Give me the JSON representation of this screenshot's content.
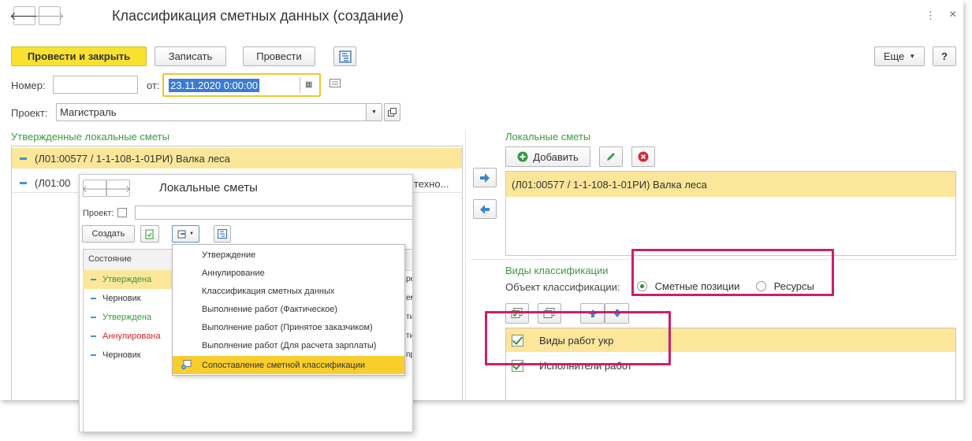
{
  "window": {
    "title": "Классификация сметных данных (создание)",
    "more_icon": "⋮",
    "close_icon": "×"
  },
  "toolbar": {
    "post_close": "Провести и закрыть",
    "save": "Записать",
    "post": "Провести",
    "more": "Еще",
    "help": "?"
  },
  "form": {
    "number_label": "Номер:",
    "number_value": "",
    "from_label": "от:",
    "date_value": "23.11.2020  0:00:00",
    "project_label": "Проект:",
    "project_value": "Магистраль"
  },
  "approved": {
    "title": "Утвержденные локальные сметы",
    "rows": [
      {
        "text": "(Л01:00577 / 1-1-108-1-01РИ) Валка леса"
      },
      {
        "text": "(Л01:00",
        "tail": "техно..."
      }
    ]
  },
  "local": {
    "title": "Локальные сметы",
    "add": "Добавить",
    "rows": [
      {
        "text": "(Л01:00577 / 1-1-108-1-01РИ) Валка леса"
      }
    ]
  },
  "classification": {
    "title": "Виды классификации",
    "object_label": "Объект классификации:",
    "options": [
      "Сметные позиции",
      "Ресурсы"
    ],
    "selected": "Сметные позиции",
    "rows": [
      {
        "label": "Виды работ укр",
        "checked": true
      },
      {
        "label": "Исполнители работ",
        "checked": true
      }
    ]
  },
  "popup": {
    "title": "Локальные сметы",
    "project_label": "Проект:",
    "create": "Создать",
    "state_header": "Состояние",
    "rows": [
      {
        "state": "Утверждена",
        "color": "#3a9a3a",
        "tail": "ре"
      },
      {
        "state": "Черновик",
        "color": "#333333",
        "tail": "ем"
      },
      {
        "state": "Утверждена",
        "color": "#3a9a3a",
        "tail": "ти"
      },
      {
        "state": "Аннулирована",
        "color": "#d62020",
        "tail": "ти"
      },
      {
        "state": "Черновик",
        "color": "#333333",
        "tail": "пр"
      }
    ]
  },
  "menu": {
    "items": [
      "Утверждение",
      "Аннулирование",
      "Классификация сметных данных",
      "Выполнение работ (Фактическое)",
      "Выполнение работ (Принятое заказчиком)",
      "Выполнение работ (Для расчета зарплаты)",
      "Сопоставление сметной классификации"
    ],
    "highlighted": "Сопоставление сметной классификации"
  }
}
